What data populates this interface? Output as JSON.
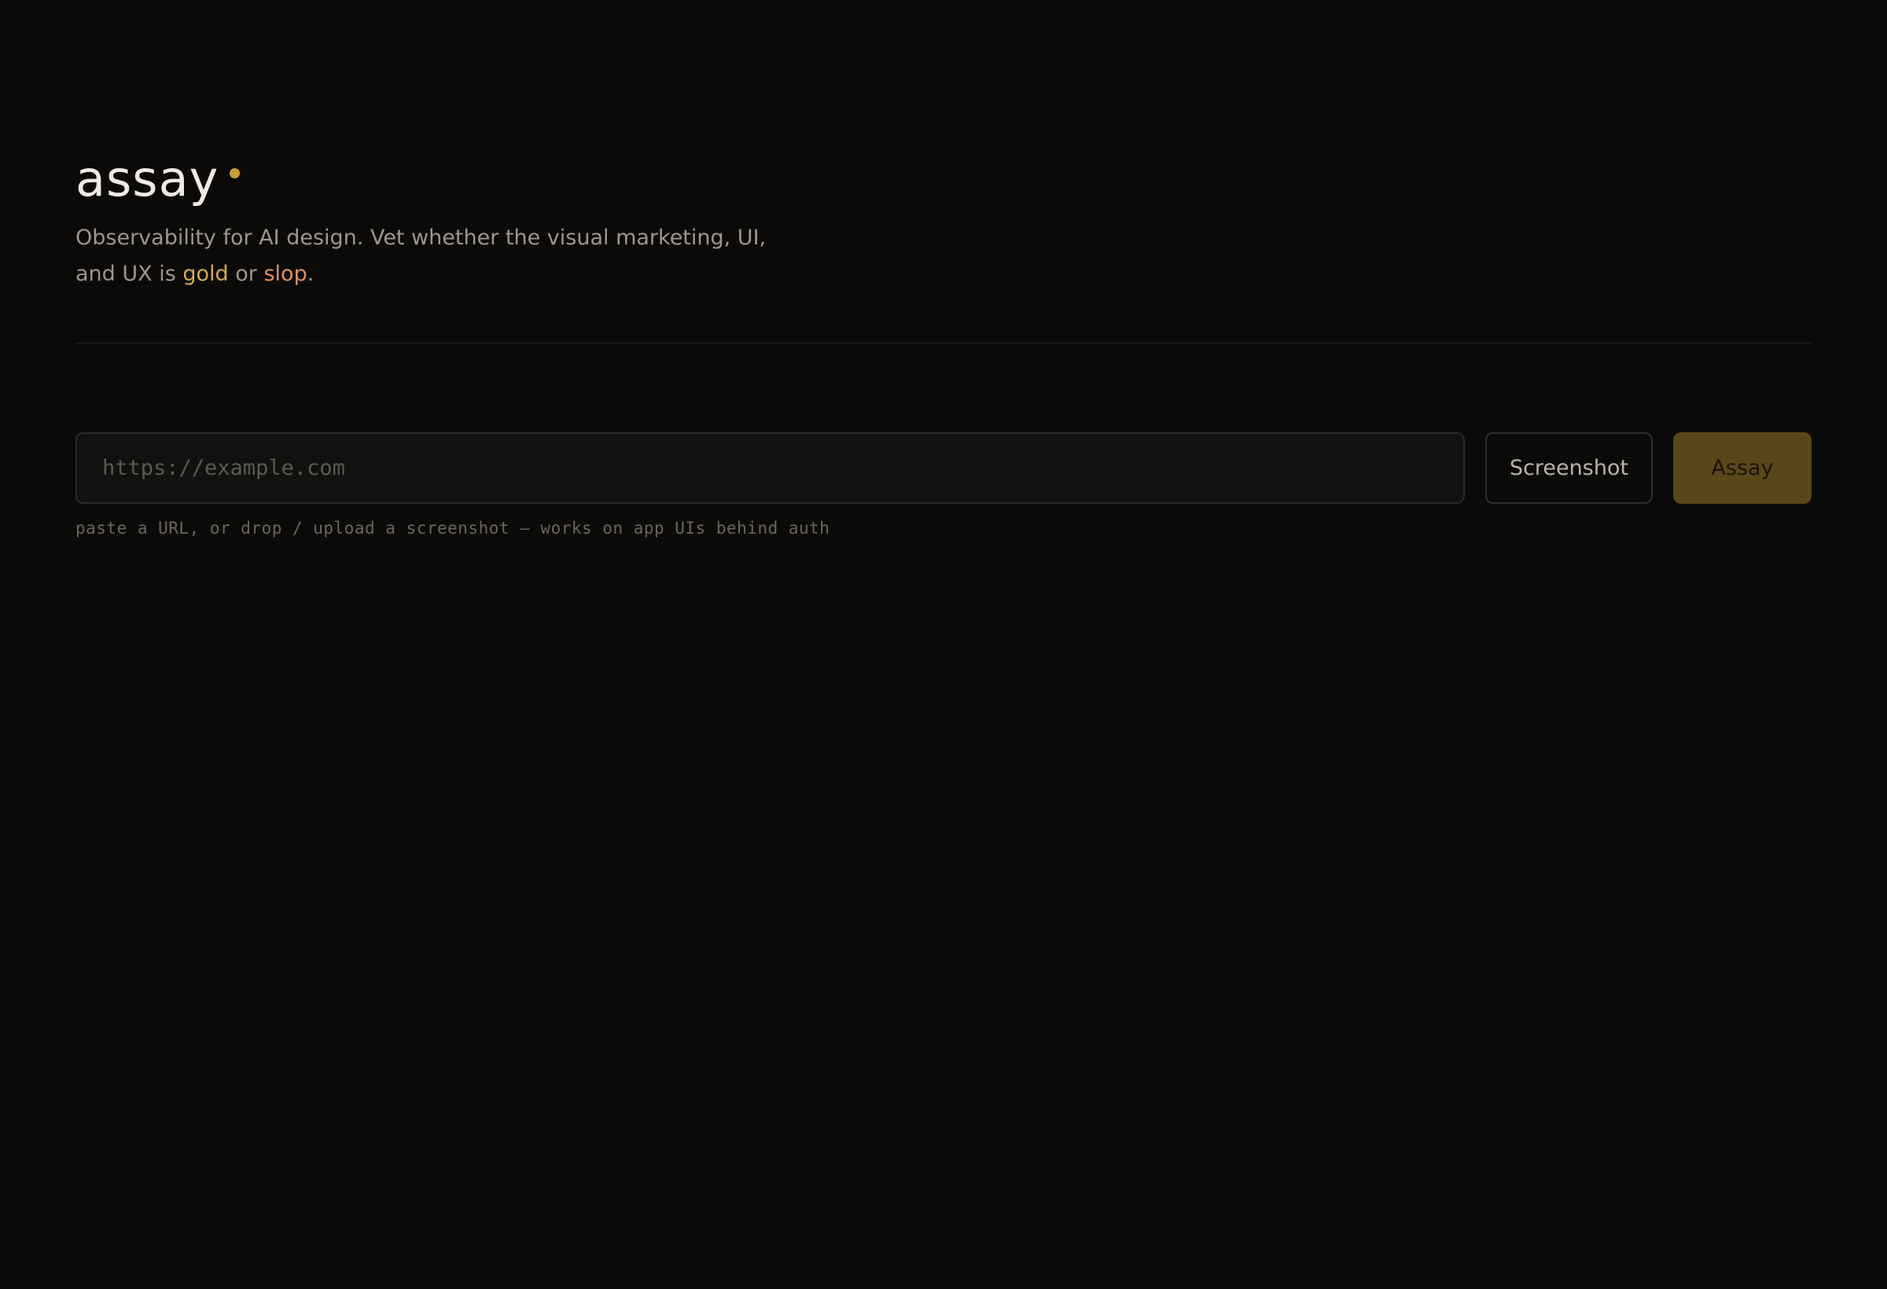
{
  "brand": {
    "title": "assay",
    "accent_color": "#c9a13a"
  },
  "tagline": {
    "line_prefix": "Observability for AI design. Vet whether the visual marketing, UI, and UX is ",
    "gold_word": "gold",
    "connector": " or ",
    "slop_word": "slop",
    "suffix": ".",
    "gold_color": "#d4ad43",
    "slop_color": "#e08f5e"
  },
  "form": {
    "url_placeholder": "https://example.com",
    "url_value": "",
    "screenshot_label": "Screenshot",
    "assay_label": "Assay",
    "hint": "paste a URL, or drop / upload a screenshot — works on app UIs behind auth"
  },
  "colors": {
    "background": "#0b0a09",
    "primary_button": "#5a4719"
  }
}
